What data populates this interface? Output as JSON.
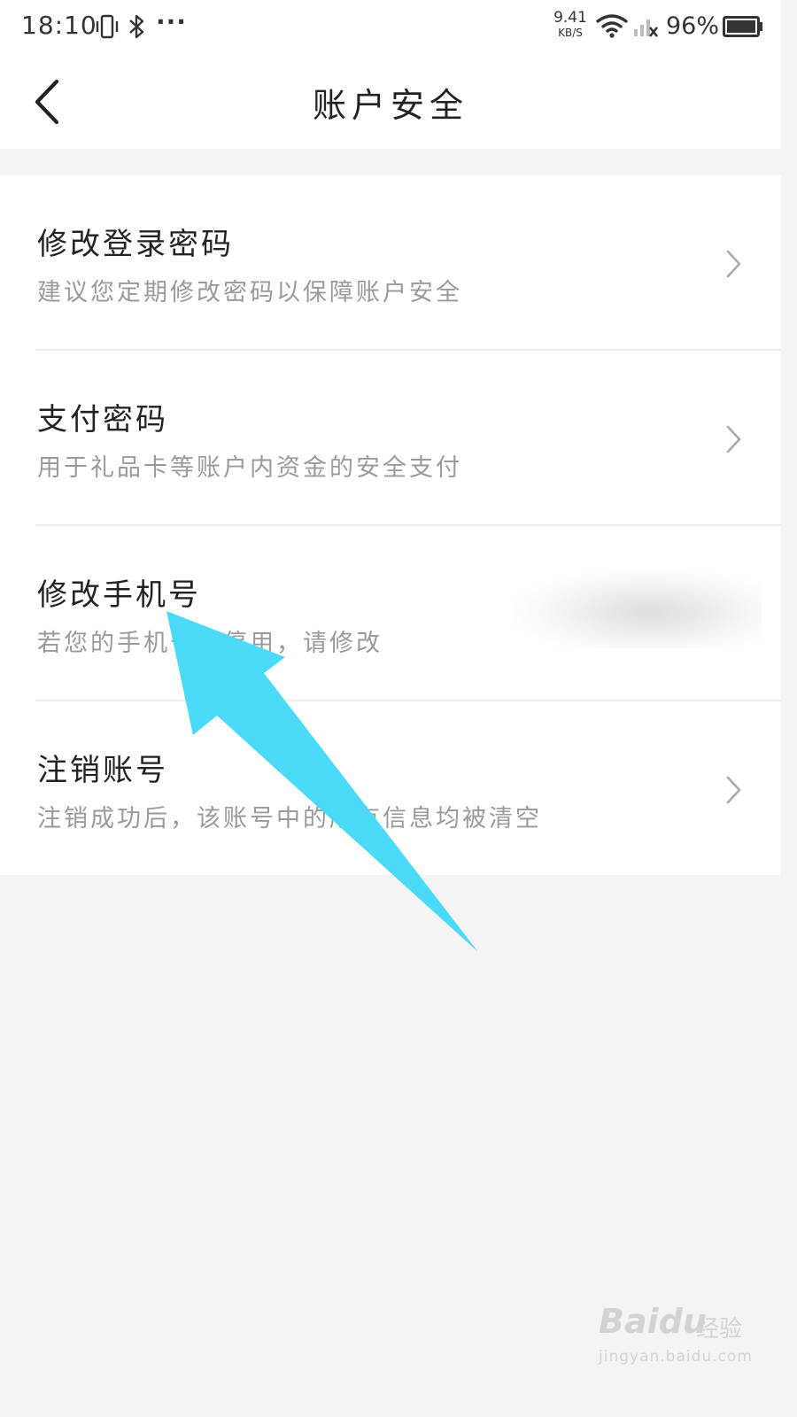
{
  "status_bar": {
    "time": "18:10",
    "dots": "···",
    "net_speed_value": "9.41",
    "net_speed_unit": "KB/S",
    "battery_percent": "96%"
  },
  "header": {
    "title": "账户安全"
  },
  "settings": {
    "items": [
      {
        "title": "修改登录密码",
        "subtitle": "建议您定期修改密码以保障账户安全"
      },
      {
        "title": "支付密码",
        "subtitle": "用于礼品卡等账户内资金的安全支付"
      },
      {
        "title": "修改手机号",
        "subtitle": "若您的手机号已停用，请修改"
      },
      {
        "title": "注销账号",
        "subtitle": "注销成功后，该账号中的所有信息均被清空"
      }
    ]
  },
  "annotation": {
    "arrow_color": "#4adaf7"
  },
  "watermark": {
    "logo_text": "Baidu",
    "jingyan": "经验",
    "url": "jingyan.baidu.com"
  },
  "colors": {
    "page_bg": "#f4f4f4",
    "card_bg": "#ffffff",
    "title_text": "#222222",
    "subtitle_text": "#9a9a9a"
  }
}
